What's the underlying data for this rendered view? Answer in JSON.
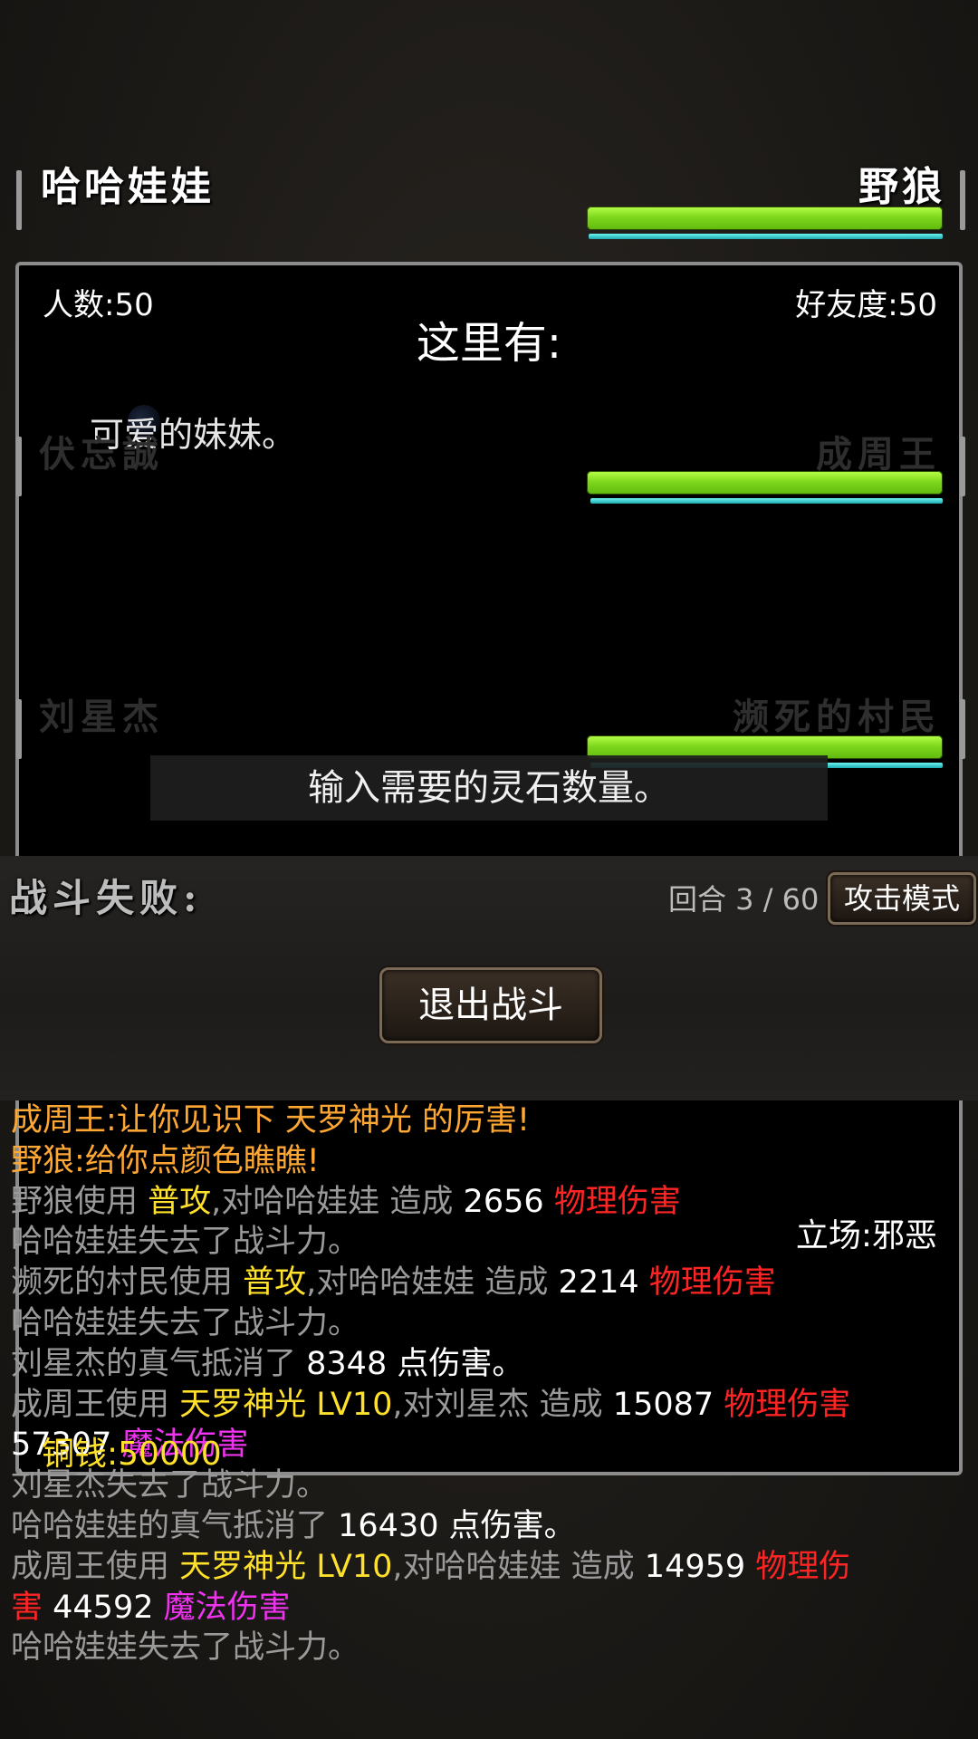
{
  "player": {
    "name": "哈哈娃娃"
  },
  "enemy": {
    "name": "野狼",
    "hp": 1.0,
    "mp": 1.0
  },
  "info": {
    "count_label": "人数:50",
    "friendship_label": "好友度:50",
    "here_title": "这里有:",
    "here_desc": "可爱的妹妹。",
    "copper_label": "铜钱:50000",
    "alignment_label": "立场:邪恶"
  },
  "combatants": {
    "left": [
      "伏忘誠",
      "刘星杰"
    ],
    "right": [
      {
        "name": "成周王",
        "hp": 1.0,
        "mp": 1.0
      },
      {
        "name": "濒死的村民",
        "hp": 1.0,
        "mp": 1.0
      }
    ]
  },
  "prompt": "输入需要的灵石数量。",
  "battle": {
    "result_label": "战斗失败:",
    "round_label": "回合 3 / 60",
    "attack_mode_button": "攻击模式",
    "exit_button": "退出战斗"
  },
  "log": [
    [
      {
        "t": "成周王:让你见识下 天罗神光 的厉害!",
        "c": "orange"
      }
    ],
    [
      {
        "t": "野狼:给你点颜色瞧瞧!",
        "c": "orange"
      }
    ],
    [
      {
        "t": "野狼使用 ",
        "c": "gray"
      },
      {
        "t": "普攻",
        "c": "yellow"
      },
      {
        "t": ",对哈哈娃娃 造成 ",
        "c": "gray"
      },
      {
        "t": "2656 ",
        "c": "white"
      },
      {
        "t": "物理伤害",
        "c": "red"
      }
    ],
    [
      {
        "t": "哈哈娃娃失去了战斗力。",
        "c": "gray"
      }
    ],
    [
      {
        "t": "濒死的村民使用 ",
        "c": "gray"
      },
      {
        "t": "普攻",
        "c": "yellow"
      },
      {
        "t": ",对哈哈娃娃 造成 ",
        "c": "gray"
      },
      {
        "t": "2214 ",
        "c": "white"
      },
      {
        "t": "物理伤害",
        "c": "red"
      }
    ],
    [
      {
        "t": "哈哈娃娃失去了战斗力。",
        "c": "gray"
      }
    ],
    [
      {
        "t": "刘星杰的真气抵消了 ",
        "c": "gray"
      },
      {
        "t": "8348 点伤害。",
        "c": "white"
      }
    ],
    [
      {
        "t": "成周王使用 ",
        "c": "gray"
      },
      {
        "t": "天罗神光 LV10",
        "c": "yellow"
      },
      {
        "t": ",对刘星杰 造成 ",
        "c": "gray"
      },
      {
        "t": "15087 ",
        "c": "white"
      },
      {
        "t": "物理伤害",
        "c": "red"
      }
    ],
    [
      {
        "t": "57307 ",
        "c": "white"
      },
      {
        "t": "魔法伤害",
        "c": "magenta"
      }
    ],
    [
      {
        "t": "刘星杰失去了战斗力。",
        "c": "gray"
      }
    ],
    [
      {
        "t": "哈哈娃娃的真气抵消了 ",
        "c": "gray"
      },
      {
        "t": "16430 点伤害。",
        "c": "white"
      }
    ],
    [
      {
        "t": "成周王使用 ",
        "c": "gray"
      },
      {
        "t": "天罗神光 LV10",
        "c": "yellow"
      },
      {
        "t": ",对哈哈娃娃 造成 ",
        "c": "gray"
      },
      {
        "t": "14959 ",
        "c": "white"
      },
      {
        "t": "物理伤",
        "c": "red"
      }
    ],
    [
      {
        "t": "害",
        "c": "red"
      },
      {
        "t": " 44592 ",
        "c": "white"
      },
      {
        "t": "魔法伤害",
        "c": "magenta"
      }
    ],
    [
      {
        "t": "哈哈娃娃失去了战斗力。",
        "c": "gray"
      }
    ]
  ]
}
